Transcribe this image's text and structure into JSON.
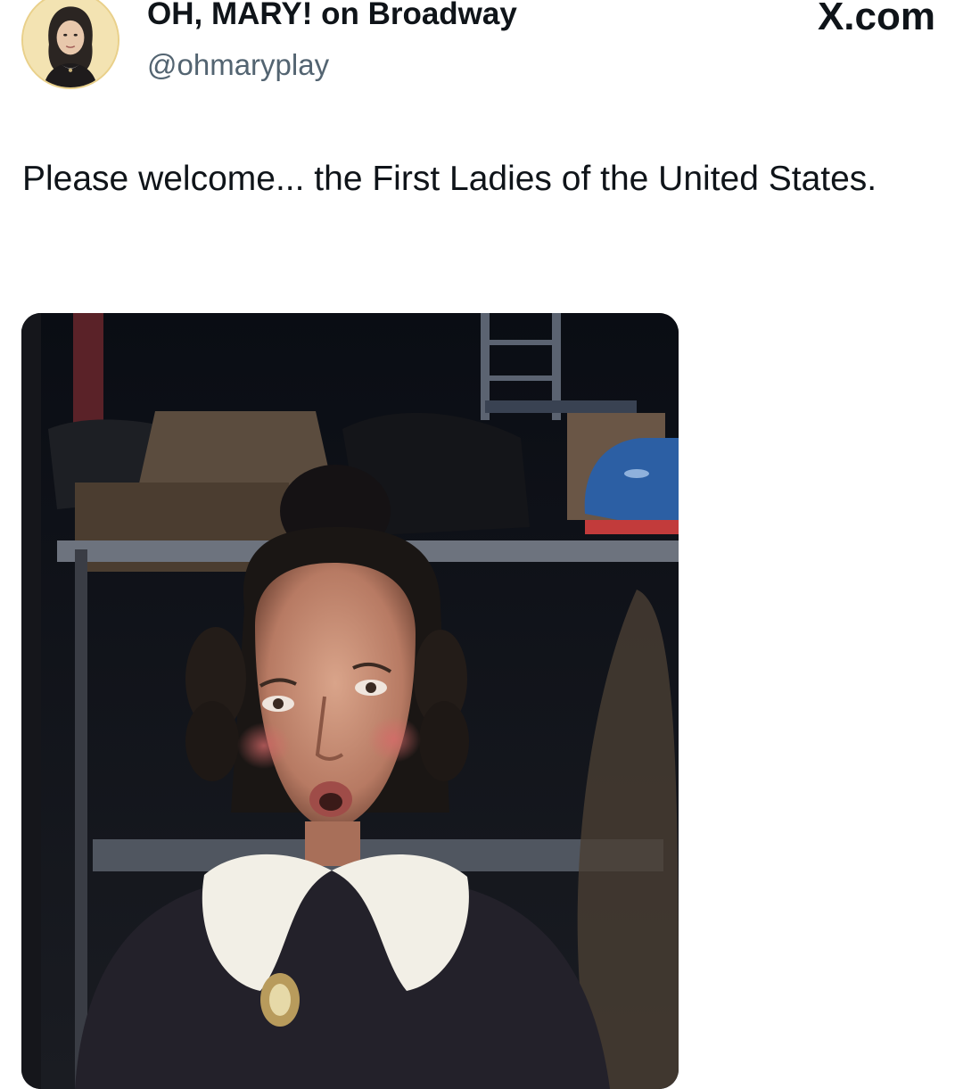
{
  "tweet": {
    "display_name": "OH, MARY! on Broadway",
    "handle": "@ohmaryplay",
    "site": "X.com",
    "text": "Please welcome... the First Ladies of the United States.",
    "avatar_icon": "profile-avatar",
    "media_icon": "video-still"
  },
  "colors": {
    "text": "#0f1419",
    "secondary_text": "#536471",
    "background": "#ffffff"
  }
}
